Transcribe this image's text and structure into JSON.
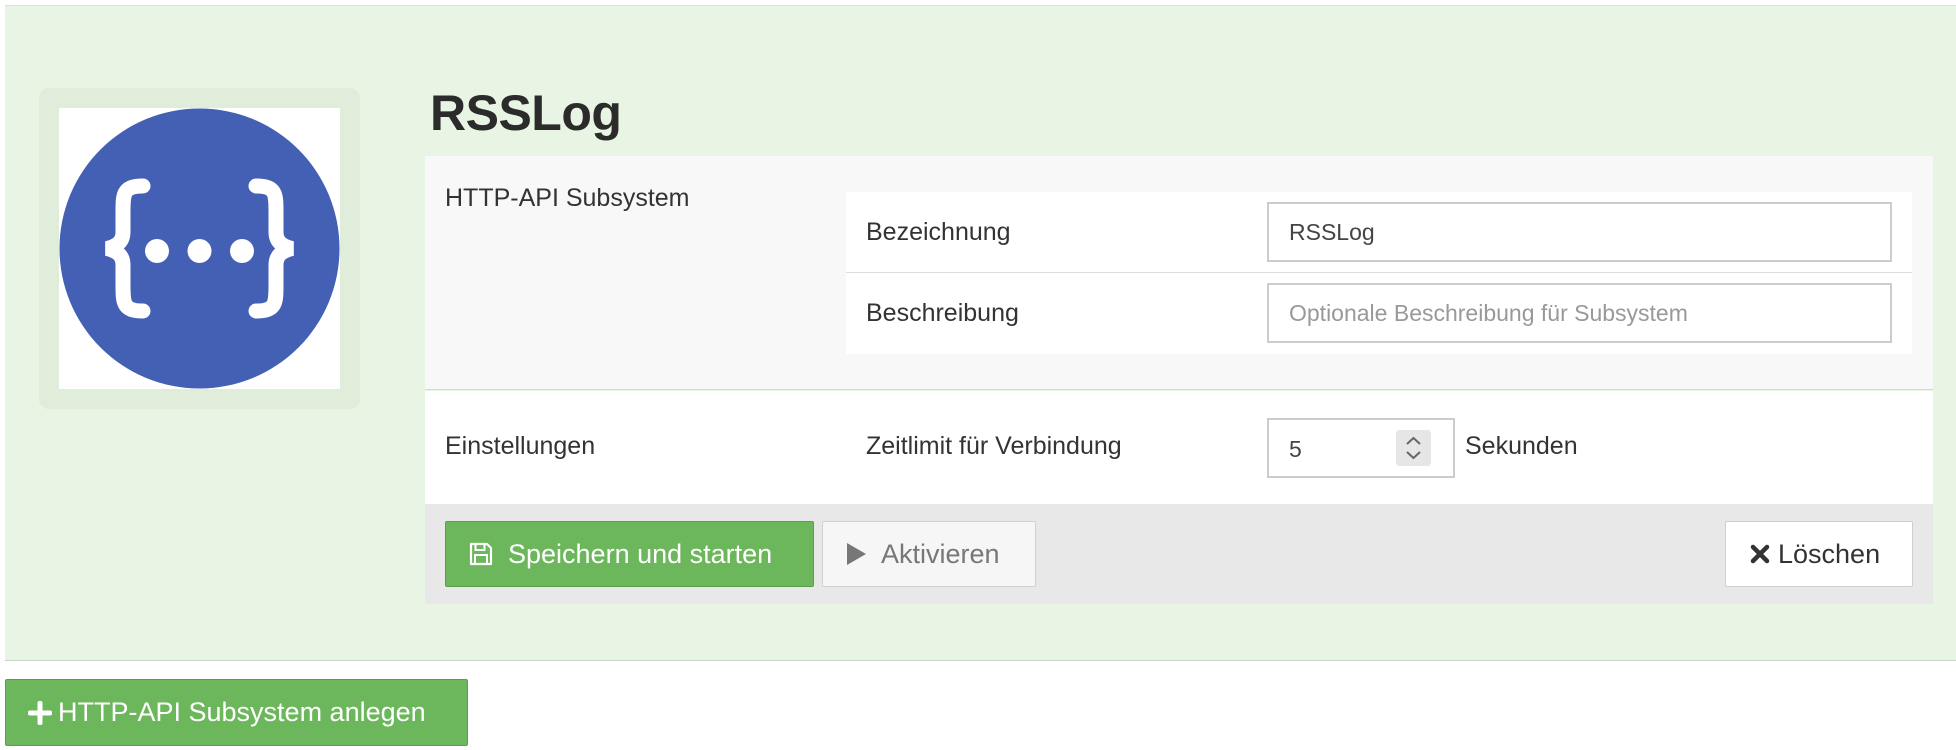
{
  "subsystem": {
    "name": "RSSLog",
    "type_label": "HTTP-API Subsystem",
    "icon": "json-braces-icon",
    "icon_color": "#4460b4"
  },
  "fields": {
    "designation_label": "Bezeichnung",
    "designation_value": "RSSLog",
    "description_label": "Beschreibung",
    "description_placeholder": "Optionale Beschreibung für Subsystem",
    "description_value": ""
  },
  "settings": {
    "section_label": "Einstellungen",
    "timeout_label": "Zeitlimit für Verbindung",
    "timeout_value": "5",
    "timeout_unit": "Sekunden"
  },
  "actions": {
    "save_label": "Speichern und starten",
    "activate_label": "Aktivieren",
    "delete_label": "Löschen",
    "add_label": "HTTP-API Subsystem anlegen"
  },
  "colors": {
    "panel_bg": "#e8f5e4",
    "success": "#6cb75b",
    "footer_bg": "#e8e8e8"
  }
}
